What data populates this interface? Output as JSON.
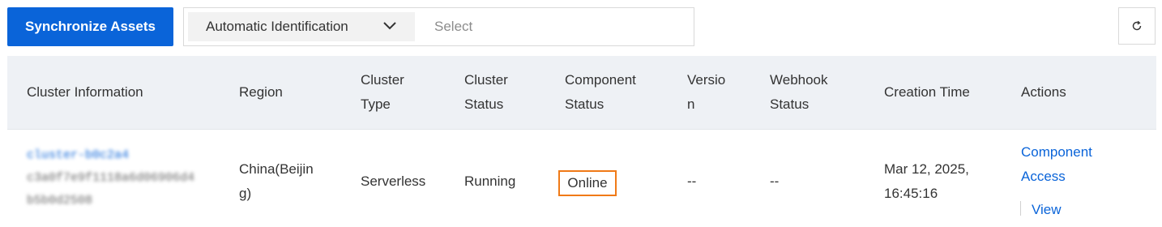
{
  "toolbar": {
    "sync_label": "Synchronize Assets",
    "filter_select_value": "Automatic Identification",
    "search_placeholder": "Select"
  },
  "table": {
    "headers": {
      "cluster_info": "Cluster Information",
      "region": "Region",
      "cluster_type_1": "Cluster",
      "cluster_type_2": "Type",
      "cluster_status_1": "Cluster",
      "cluster_status_2": "Status",
      "component_status_1": "Component",
      "component_status_2": "Status",
      "version_1": "Versio",
      "version_2": "n",
      "webhook_status_1": "Webhook",
      "webhook_status_2": "Status",
      "creation_time": "Creation Time",
      "actions": "Actions"
    },
    "rows": [
      {
        "cluster_name": "cluster-b0c2a4",
        "cluster_id_1": "c3a0f7e9f1118a6d06906d4",
        "cluster_id_2": "b5b0d2508",
        "region_1": "China(Beijin",
        "region_2": "g)",
        "cluster_type": "Serverless",
        "cluster_status": "Running",
        "component_status": "Online",
        "version": "--",
        "webhook_status": "--",
        "creation_time_1": "Mar 12, 2025,",
        "creation_time_2": "16:45:16",
        "action_component_access_1": "Component",
        "action_component_access_2": "Access",
        "action_view": "View"
      }
    ]
  },
  "colors": {
    "primary": "#0a64d9",
    "highlight": "#f07a17",
    "header_bg": "#eef1f5"
  },
  "icons": {
    "dropdown": "chevron-down-icon",
    "refresh": "refresh-icon"
  }
}
